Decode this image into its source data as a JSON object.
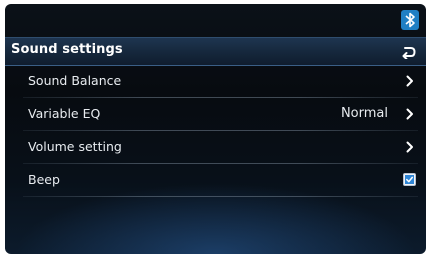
{
  "status_bar": {
    "icons": [
      "bluetooth-icon"
    ]
  },
  "header": {
    "title": "Sound settings",
    "back_icon": "back-arrow-icon"
  },
  "menu": {
    "items": [
      {
        "label": "Sound Balance",
        "value": "",
        "control": "chevron-right-icon"
      },
      {
        "label": "Variable EQ",
        "value": "Normal",
        "control": "chevron-right-icon"
      },
      {
        "label": "Volume setting",
        "value": "",
        "control": "chevron-right-icon"
      },
      {
        "label": "Beep",
        "value": "",
        "control": "checkbox",
        "checked": true
      }
    ]
  },
  "colors": {
    "accent_blue": "#2aa0e6",
    "header_bg": "#16283d",
    "text": "#e8ecf0"
  }
}
